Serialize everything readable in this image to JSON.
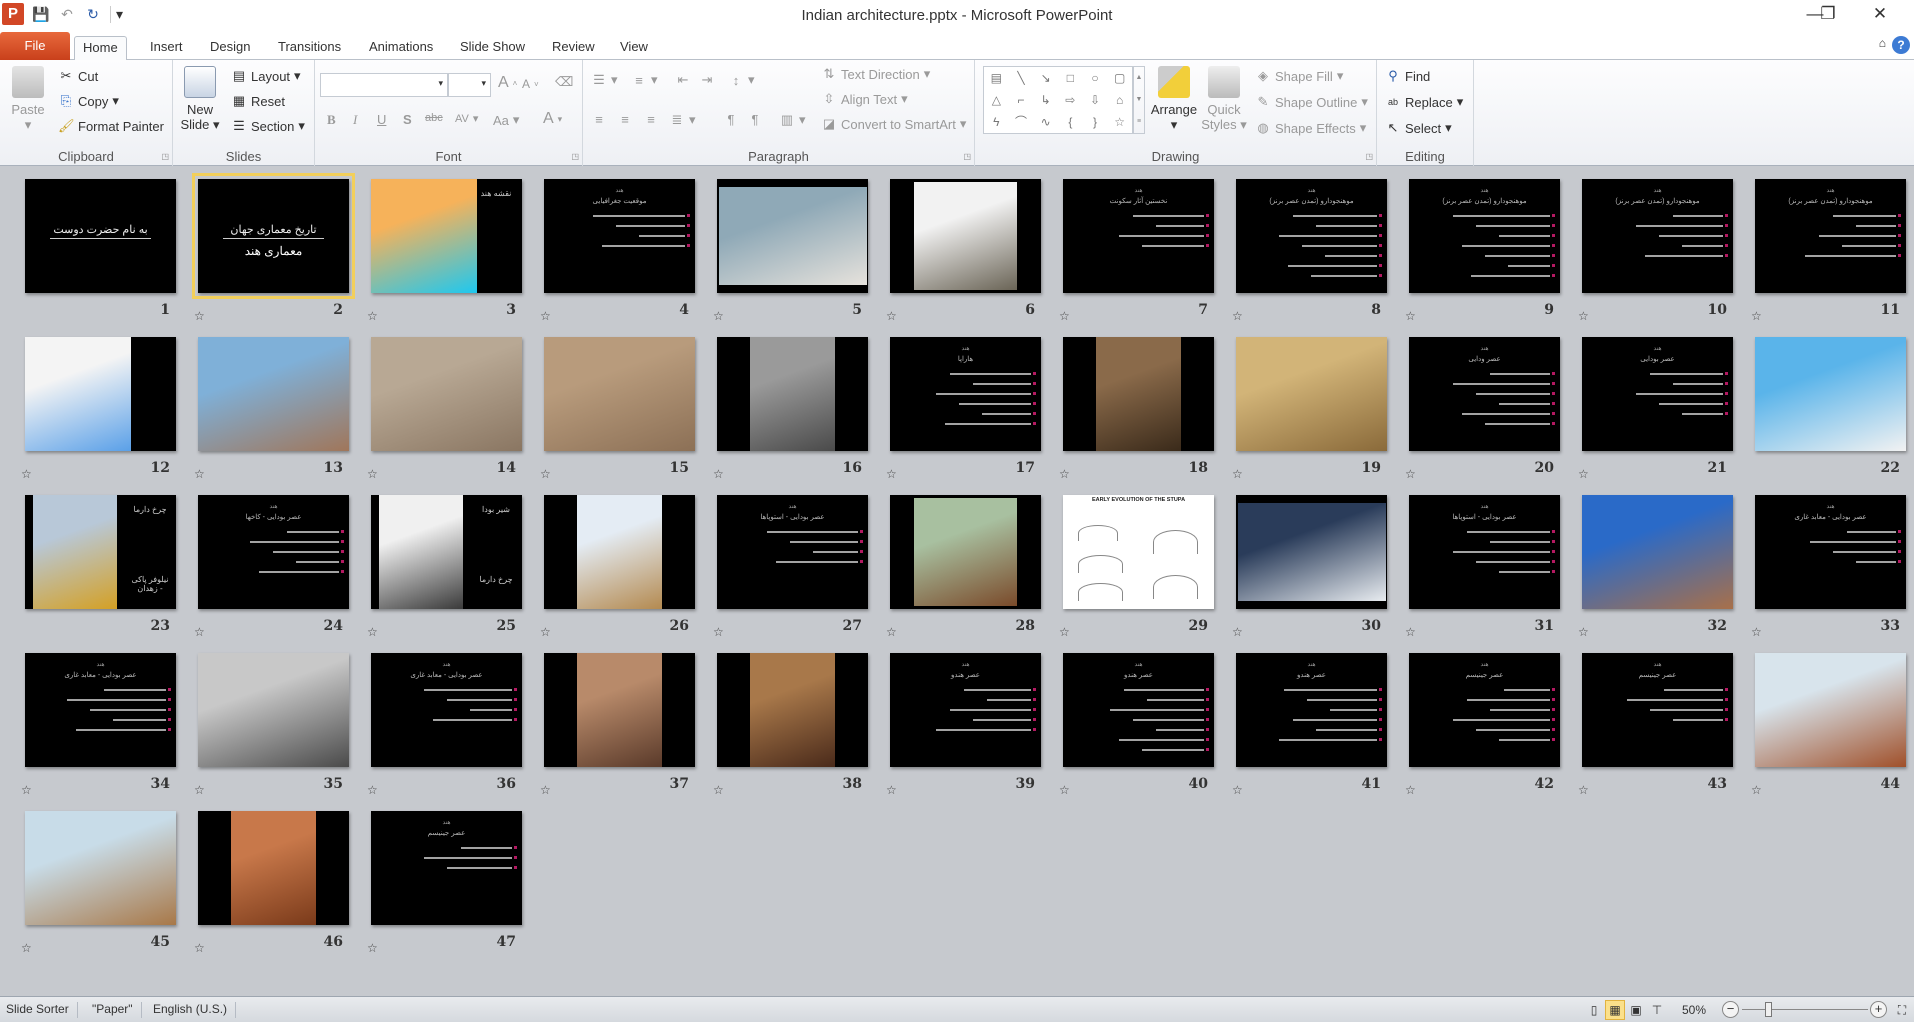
{
  "window": {
    "title": "Indian architecture.pptx  -  Microsoft PowerPoint",
    "minimize": "—",
    "restore": "❐",
    "close": "✕"
  },
  "qat": {
    "app_icon": "P",
    "save": "💾",
    "undo": "↶",
    "redo": "↻",
    "customize": "▾"
  },
  "tabs": [
    {
      "label": "File"
    },
    {
      "label": "Home",
      "active": true
    },
    {
      "label": "Insert"
    },
    {
      "label": "Design"
    },
    {
      "label": "Transitions"
    },
    {
      "label": "Animations"
    },
    {
      "label": "Slide Show"
    },
    {
      "label": "Review"
    },
    {
      "label": "View"
    }
  ],
  "ribbon": {
    "clipboard": {
      "label": "Clipboard",
      "paste": "Paste",
      "cut": "Cut",
      "copy": "Copy",
      "format_painter": "Format Painter"
    },
    "slides": {
      "label": "Slides",
      "new_slide": "New Slide",
      "layout": "Layout",
      "reset": "Reset",
      "section": "Section"
    },
    "font": {
      "label": "Font",
      "font_name": "",
      "font_size": "",
      "bold": "B",
      "italic": "I",
      "underline": "U",
      "shadow": "S",
      "strike": "abc",
      "spacing": "AV",
      "case": "Aa",
      "color": "A",
      "grow": "A",
      "shrink": "A"
    },
    "paragraph": {
      "label": "Paragraph",
      "text_direction": "Text Direction",
      "align_text": "Align Text",
      "convert_smartart": "Convert to SmartArt"
    },
    "drawing": {
      "label": "Drawing",
      "arrange": "Arrange",
      "quick_styles": "Quick Styles",
      "shape_fill": "Shape Fill",
      "shape_outline": "Shape Outline",
      "shape_effects": "Shape Effects",
      "shapes": [
        "▤",
        "╲",
        "↘",
        "□",
        "○",
        "▢",
        "△",
        "⌐",
        "↳",
        "⇨",
        "⇩",
        "⌂",
        "ϟ",
        "⌒",
        "∿",
        "{",
        "}",
        "☆"
      ]
    },
    "editing": {
      "label": "Editing",
      "find": "Find",
      "replace": "Replace",
      "select": "Select"
    }
  },
  "slides": [
    {
      "n": 1,
      "star": false,
      "kind": "title",
      "title": "به نام حضرت دوست"
    },
    {
      "n": 2,
      "star": true,
      "kind": "title",
      "title": "تاریخ معماری جهان",
      "subtitle": "معماری هند",
      "selected": true
    },
    {
      "n": 3,
      "star": true,
      "kind": "image",
      "fit": "left70",
      "colors": [
        "#f6b25a",
        "#1ec8f0"
      ],
      "captions": [
        "نقشه هند"
      ]
    },
    {
      "n": 4,
      "star": true,
      "kind": "text",
      "heading": "هند",
      "subheading": "موقعیت جغرافیایی",
      "bullets": 4
    },
    {
      "n": 5,
      "star": true,
      "kind": "image",
      "fit": "letterbox",
      "colors": [
        "#8fa9b7",
        "#e6e2dc"
      ]
    },
    {
      "n": 6,
      "star": true,
      "kind": "image",
      "fit": "box",
      "colors": [
        "#f2f2f2",
        "#6a6456"
      ]
    },
    {
      "n": 7,
      "star": true,
      "kind": "text",
      "heading": "هند",
      "subheading": "نخستین آثار سکونت",
      "bullets": 4
    },
    {
      "n": 8,
      "star": true,
      "kind": "text",
      "heading": "هند",
      "subheading": "موهنجودارو (تمدن عصر برنز)",
      "bullets": 7
    },
    {
      "n": 9,
      "star": true,
      "kind": "text",
      "heading": "هند",
      "subheading": "موهنجودارو (تمدن عصر برنز)",
      "bullets": 7
    },
    {
      "n": 10,
      "star": true,
      "kind": "text",
      "heading": "هند",
      "subheading": "موهنجودارو (تمدن عصر برنز)",
      "bullets": 5
    },
    {
      "n": 11,
      "star": true,
      "kind": "text",
      "heading": "هند",
      "subheading": "موهنجودارو (تمدن عصر برنز)",
      "bullets": 5
    },
    {
      "n": 12,
      "star": true,
      "kind": "image",
      "fit": "left70",
      "colors": [
        "#f4f4f4",
        "#5aa0e8"
      ]
    },
    {
      "n": 13,
      "star": true,
      "kind": "image",
      "fit": "full",
      "colors": [
        "#7fb0d8",
        "#a0765a"
      ]
    },
    {
      "n": 14,
      "star": true,
      "kind": "image",
      "fit": "full",
      "colors": [
        "#b8a894",
        "#8a7662"
      ]
    },
    {
      "n": 15,
      "star": true,
      "kind": "image",
      "fit": "full",
      "colors": [
        "#b89b7c",
        "#8c7056"
      ]
    },
    {
      "n": 16,
      "star": true,
      "kind": "image",
      "fit": "center",
      "colors": [
        "#9a9a9a",
        "#4a4a4a"
      ]
    },
    {
      "n": 17,
      "star": true,
      "kind": "text",
      "heading": "هند",
      "subheading": "هاراپا",
      "bullets": 6
    },
    {
      "n": 18,
      "star": true,
      "kind": "image",
      "fit": "center",
      "colors": [
        "#8a6a4a",
        "#3a2a1a"
      ]
    },
    {
      "n": 19,
      "star": true,
      "kind": "image",
      "fit": "full",
      "colors": [
        "#d2b478",
        "#8a6a3a"
      ]
    },
    {
      "n": 20,
      "star": true,
      "kind": "text",
      "heading": "هند",
      "subheading": "عصر ودایی",
      "bullets": 6
    },
    {
      "n": 21,
      "star": true,
      "kind": "text",
      "heading": "هند",
      "subheading": "عصر بودایی",
      "bullets": 5
    },
    {
      "n": 22,
      "star": false,
      "kind": "image",
      "fit": "full",
      "colors": [
        "#5ab4ea",
        "#f2f2f2"
      ]
    },
    {
      "n": 23,
      "star": false,
      "kind": "image",
      "fit": "left",
      "colors": [
        "#b8c8d8",
        "#d4a024"
      ],
      "captions": [
        "چرخ دارما",
        "نیلوفر پاکی - زهدان"
      ]
    },
    {
      "n": 24,
      "star": true,
      "kind": "text",
      "heading": "هند",
      "subheading": "عصر بودایی - کاخها",
      "bullets": 5
    },
    {
      "n": 25,
      "star": true,
      "kind": "image",
      "fit": "left",
      "colors": [
        "#f0f0f0",
        "#3a3a3a"
      ],
      "captions": [
        "شیر بودا",
        "چرخ دارما"
      ]
    },
    {
      "n": 26,
      "star": true,
      "kind": "image",
      "fit": "center",
      "colors": [
        "#e4ecf4",
        "#b48a50"
      ]
    },
    {
      "n": 27,
      "star": true,
      "kind": "text",
      "heading": "هند",
      "subheading": "عصر بودایی - استوپاها",
      "bullets": 4
    },
    {
      "n": 28,
      "star": true,
      "kind": "image",
      "fit": "box",
      "colors": [
        "#a8c0a0",
        "#7a4a2a"
      ]
    },
    {
      "n": 29,
      "star": true,
      "kind": "diagram",
      "title": "EARLY EVOLUTION OF THE STUPA"
    },
    {
      "n": 30,
      "star": true,
      "kind": "image",
      "fit": "letterbox",
      "colors": [
        "#2a3c5a",
        "#e8ecf0"
      ]
    },
    {
      "n": 31,
      "star": true,
      "kind": "text",
      "heading": "هند",
      "subheading": "عصر بودایی - استوپاها",
      "bullets": 5
    },
    {
      "n": 32,
      "star": true,
      "kind": "image",
      "fit": "full",
      "colors": [
        "#2a6ac8",
        "#a8704a"
      ]
    },
    {
      "n": 33,
      "star": true,
      "kind": "text",
      "heading": "هند",
      "subheading": "عصر بودایی - معابد غاری",
      "bullets": 4
    },
    {
      "n": 34,
      "star": true,
      "kind": "text",
      "heading": "هند",
      "subheading": "عصر بودایی - معابد غاری",
      "bullets": 5
    },
    {
      "n": 35,
      "star": true,
      "kind": "image",
      "fit": "full",
      "colors": [
        "#c8c8c8",
        "#4a4a4a"
      ]
    },
    {
      "n": 36,
      "star": true,
      "kind": "text",
      "heading": "هند",
      "subheading": "عصر بودایی - معابد غاری",
      "bullets": 4
    },
    {
      "n": 37,
      "star": true,
      "kind": "image",
      "fit": "center",
      "colors": [
        "#b88a6a",
        "#5a3a2a"
      ]
    },
    {
      "n": 38,
      "star": true,
      "kind": "image",
      "fit": "center",
      "colors": [
        "#a8784a",
        "#4a2a1a"
      ]
    },
    {
      "n": 39,
      "star": true,
      "kind": "text",
      "heading": "هند",
      "subheading": "عصر هندو",
      "bullets": 5
    },
    {
      "n": 40,
      "star": true,
      "kind": "text",
      "heading": "هند",
      "subheading": "عصر هندو",
      "bullets": 7
    },
    {
      "n": 41,
      "star": true,
      "kind": "text",
      "heading": "هند",
      "subheading": "عصر هندو",
      "bullets": 6
    },
    {
      "n": 42,
      "star": true,
      "kind": "text",
      "heading": "هند",
      "subheading": "عصر جینیسم",
      "bullets": 6
    },
    {
      "n": 43,
      "star": true,
      "kind": "text",
      "heading": "هند",
      "subheading": "عصر جینیسم",
      "bullets": 4
    },
    {
      "n": 44,
      "star": true,
      "kind": "image",
      "fit": "full",
      "colors": [
        "#d8e4ec",
        "#a0502a"
      ]
    },
    {
      "n": 45,
      "star": true,
      "kind": "image",
      "fit": "full",
      "colors": [
        "#c8dce8",
        "#a87848"
      ]
    },
    {
      "n": 46,
      "star": true,
      "kind": "image",
      "fit": "center",
      "colors": [
        "#c8784a",
        "#7a3a1a"
      ]
    },
    {
      "n": 47,
      "star": true,
      "kind": "text",
      "heading": "هند",
      "subheading": "عصر جینیسم",
      "bullets": 3
    }
  ],
  "status": {
    "view": "Slide Sorter",
    "theme": "\"Paper\"",
    "language": "English (U.S.)",
    "zoom": "50%",
    "zoom_percent": 50,
    "active_view": "slide-sorter"
  },
  "colors": {
    "file_tab": "#d24726",
    "selection": "#f2cf5b",
    "bullet": "#e0207a",
    "sorter_bg": "#c6c9ce"
  }
}
